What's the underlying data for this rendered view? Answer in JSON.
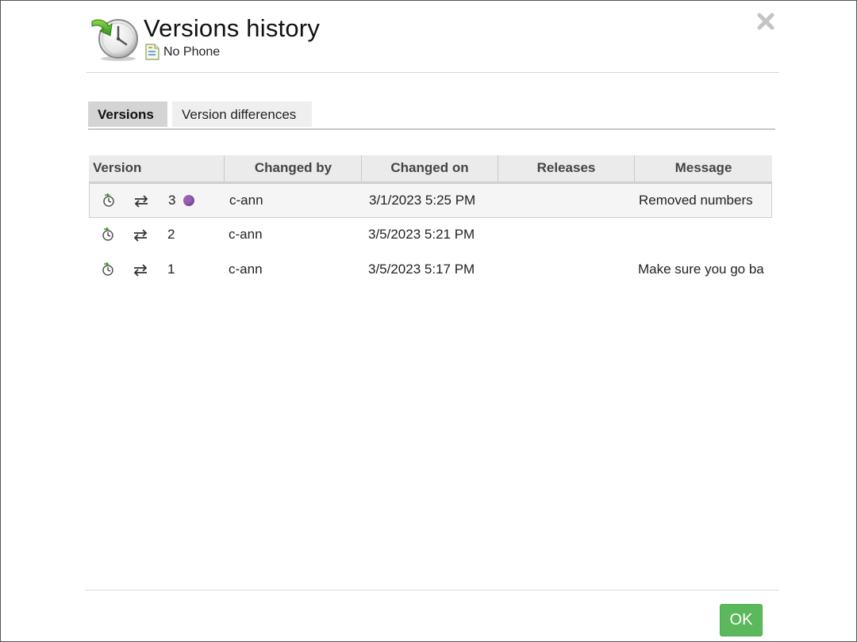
{
  "dialog": {
    "title": "Versions history",
    "subtitle": "No Phone",
    "icons": {
      "header": "history-clock-icon",
      "document": "document-icon",
      "close": "close-icon"
    }
  },
  "tabs": [
    {
      "label": "Versions",
      "active": true
    },
    {
      "label": "Version differences",
      "active": false
    }
  ],
  "table": {
    "columns": [
      "Version",
      "Changed by",
      "Changed on",
      "Releases",
      "Message"
    ],
    "rows": [
      {
        "version": "3",
        "current": true,
        "changed_by": "c-ann",
        "changed_on": "3/1/2023 5:25 PM",
        "releases": "",
        "message": "Removed numbers"
      },
      {
        "version": "2",
        "current": false,
        "changed_by": "c-ann",
        "changed_on": "3/5/2023 5:21 PM",
        "releases": "",
        "message": ""
      },
      {
        "version": "1",
        "current": false,
        "changed_by": "c-ann",
        "changed_on": "3/5/2023 5:17 PM",
        "releases": "",
        "message": "Make sure you go ba"
      }
    ],
    "row_icons": [
      "restore-clock-icon",
      "compare-arrows-icon"
    ],
    "current_marker_color": "#9a5fb5"
  },
  "footer": {
    "ok_label": "OK"
  },
  "colors": {
    "ok_button": "#5cb85c",
    "header_arrow": "#4caf28"
  }
}
